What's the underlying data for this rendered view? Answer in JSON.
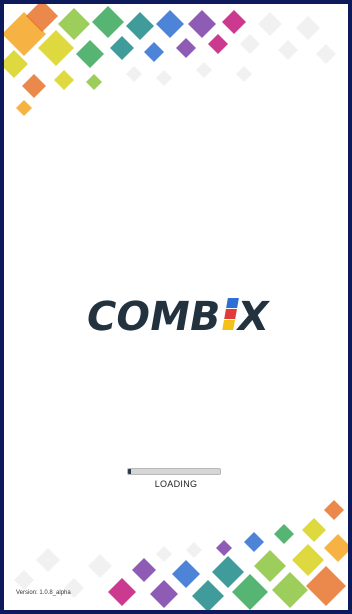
{
  "logo": {
    "text_lead": "COMB",
    "text_tail": "X"
  },
  "loading": {
    "label": "LOADING",
    "progress_fraction": 0.03
  },
  "version": {
    "text": "Version: 1.0.8_alpha"
  },
  "colors": {
    "frame_border": "#0d1a5c",
    "logo_text": "#23323f",
    "progress_fill": "#2b3a4a",
    "progress_track": "#d6d6d6",
    "logo_blocks": [
      "#2e6fd6",
      "#e23a3a",
      "#f2c21a"
    ],
    "decor_palette": [
      "#f5a623",
      "#e8732c",
      "#d9d21f",
      "#8cc63f",
      "#3aa85a",
      "#1f8a8a",
      "#2f6fd1",
      "#7b3fa8",
      "#c2187a",
      "#e7e7e7"
    ]
  }
}
